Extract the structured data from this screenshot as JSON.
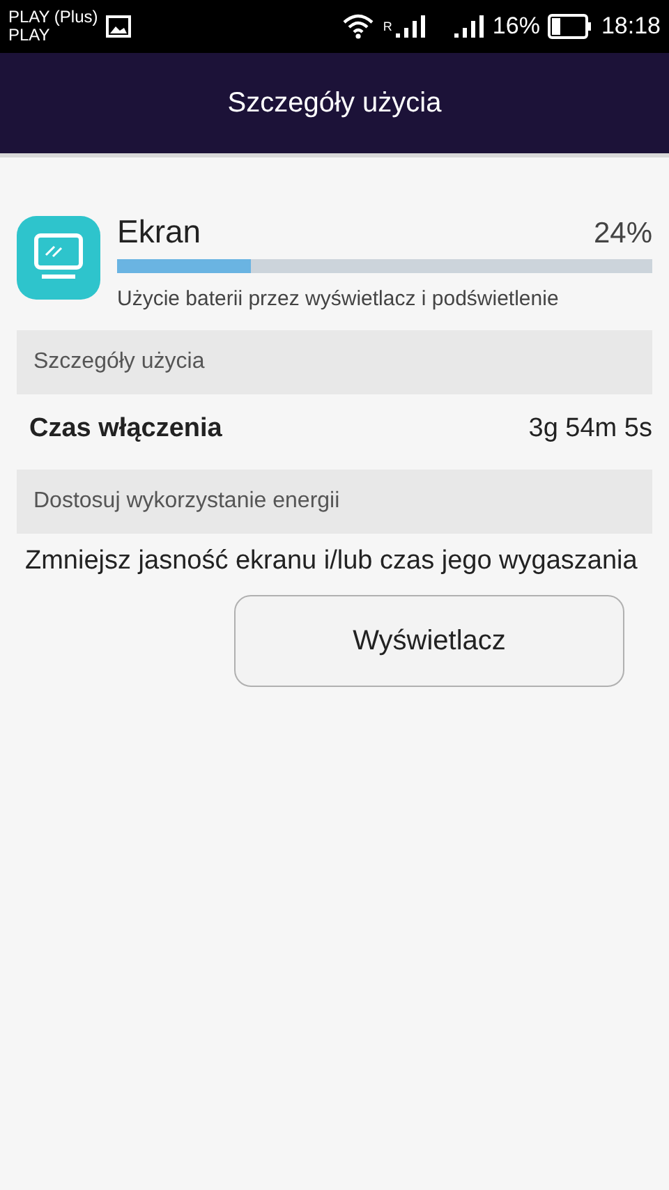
{
  "status_bar": {
    "carrier": "PLAY (Plus)",
    "carrier_2": "PLAY",
    "roaming": "R",
    "battery": "16%",
    "time": "18:18"
  },
  "app_bar": {
    "title": "Szczegóły użycia"
  },
  "usage_item": {
    "name": "Ekran",
    "percent": "24%",
    "level": 0.25,
    "description": "Użycie baterii przez wyświetlacz i podświetlenie"
  },
  "sections": [
    {
      "header": "Szczegóły użycia",
      "rows": [
        {
          "kind": "stat",
          "label": "Czas włączenia",
          "value": "3g 54m 5s"
        }
      ]
    },
    {
      "header": "Dostosuj wykorzystanie energii",
      "rows": [
        {
          "kind": "advice",
          "text": "Zmniejsz jasność ekranu i/lub czas jego wygaszania",
          "button": "Wyświetlacz"
        }
      ]
    }
  ]
}
